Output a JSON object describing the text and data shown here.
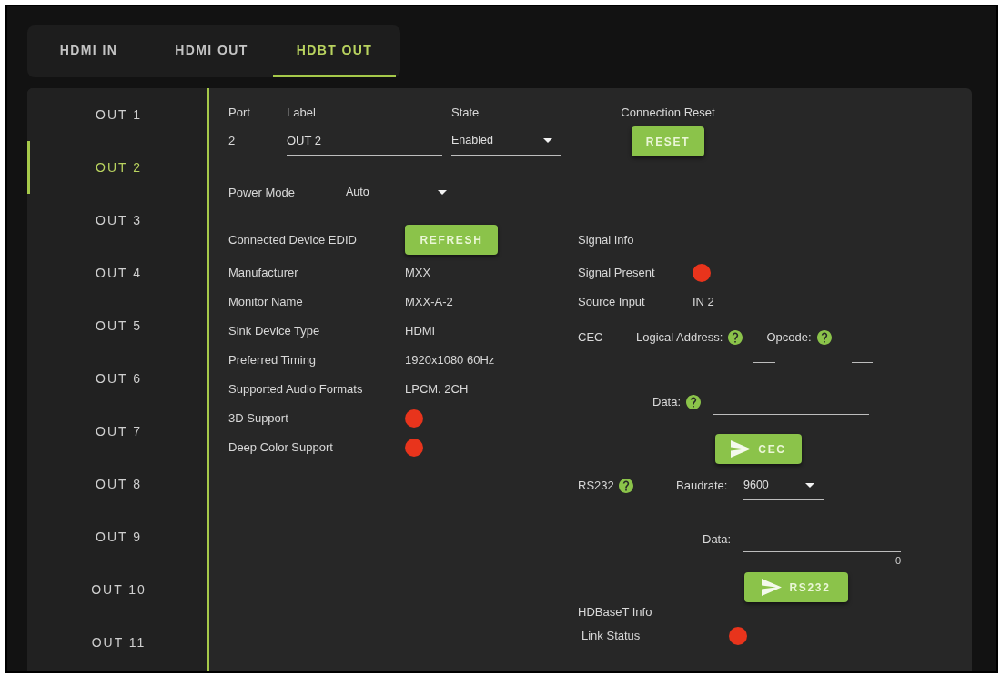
{
  "tabs": [
    {
      "label": "HDMI IN",
      "selected": false
    },
    {
      "label": "HDMI OUT",
      "selected": false
    },
    {
      "label": "HDBT OUT",
      "selected": true
    }
  ],
  "sidebar": {
    "items": [
      {
        "label": "OUT 1",
        "selected": false
      },
      {
        "label": "OUT 2",
        "selected": true
      },
      {
        "label": "OUT 3",
        "selected": false
      },
      {
        "label": "OUT 4",
        "selected": false
      },
      {
        "label": "OUT 5",
        "selected": false
      },
      {
        "label": "OUT 6",
        "selected": false
      },
      {
        "label": "OUT 7",
        "selected": false
      },
      {
        "label": "OUT 8",
        "selected": false
      },
      {
        "label": "OUT 9",
        "selected": false
      },
      {
        "label": "OUT 10",
        "selected": false
      },
      {
        "label": "OUT 11",
        "selected": false
      }
    ]
  },
  "port_settings": {
    "port": {
      "label": "Port",
      "value": "2"
    },
    "label": {
      "label": "Label",
      "value": "OUT 2"
    },
    "state": {
      "label": "State",
      "value": "Enabled"
    },
    "connection_reset": {
      "label": "Connection Reset",
      "button": "RESET"
    }
  },
  "power_mode": {
    "label": "Power Mode",
    "value": "Auto"
  },
  "edid": {
    "title": "Connected Device EDID",
    "button": "REFRESH",
    "rows": [
      {
        "label": "Manufacturer",
        "kind": "text",
        "value": "MXX"
      },
      {
        "label": "Monitor Name",
        "kind": "text",
        "value": "MXX-A-2"
      },
      {
        "label": "Sink Device Type",
        "kind": "text",
        "value": "HDMI"
      },
      {
        "label": "Preferred Timing",
        "kind": "text",
        "value": "1920x1080 60Hz"
      },
      {
        "label": "Supported Audio Formats",
        "kind": "text",
        "value": "LPCM. 2CH"
      },
      {
        "label": "3D Support",
        "kind": "indicator",
        "color": "#e8341c"
      },
      {
        "label": "Deep Color Support",
        "kind": "indicator",
        "color": "#e8341c"
      }
    ]
  },
  "signal_info": {
    "title": "Signal Info",
    "rows": [
      {
        "label": "Signal Present",
        "kind": "indicator",
        "color": "#e8341c"
      },
      {
        "label": "Source Input",
        "kind": "text",
        "value": "IN 2"
      }
    ]
  },
  "cec": {
    "label": "CEC",
    "logical_address": {
      "label": "Logical Address:"
    },
    "opcode": {
      "label": "Opcode:"
    },
    "data": {
      "label": "Data:"
    },
    "button": "CEC"
  },
  "rs232": {
    "label": "RS232",
    "baudrate": {
      "label": "Baudrate:",
      "value": "9600"
    },
    "data": {
      "label": "Data:",
      "counter": "0"
    },
    "button": "RS232"
  },
  "hdbaset_info": {
    "title": "HDBaseT Info",
    "rows": [
      {
        "label": "Link Status",
        "kind": "indicator",
        "color": "#e8341c"
      }
    ]
  }
}
